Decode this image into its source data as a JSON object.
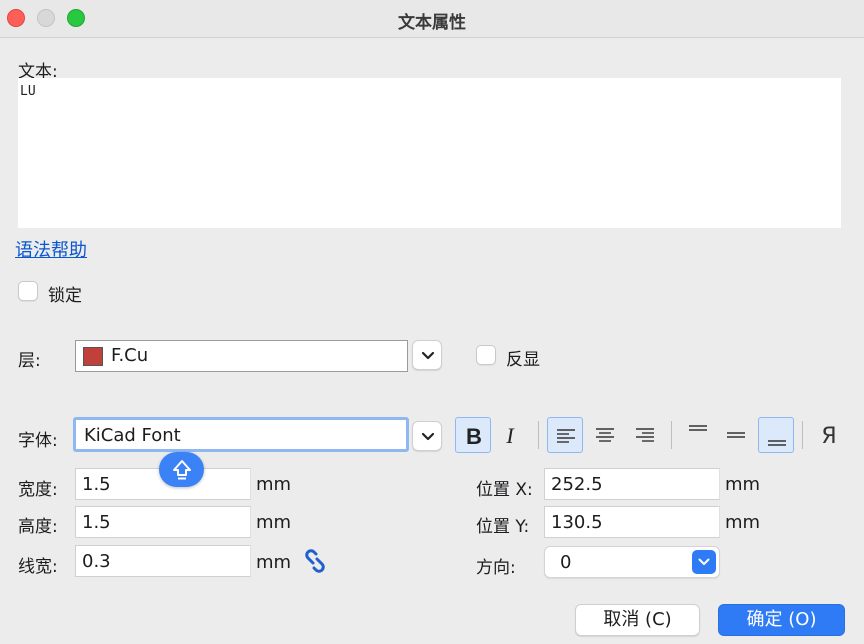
{
  "window": {
    "title": "文本属性"
  },
  "text_section": {
    "label": "文本:",
    "value": "LU"
  },
  "syntax_help_link": "语法帮助",
  "lock": {
    "label": "锁定",
    "checked": false
  },
  "layer": {
    "label": "层:",
    "value": "F.Cu",
    "swatch_color": "#c0403a"
  },
  "mirror": {
    "label": "反显",
    "checked": false
  },
  "font": {
    "label": "字体:",
    "value": "KiCad Font"
  },
  "style_buttons": {
    "bold": {
      "glyph": "B",
      "active": true
    },
    "italic": {
      "glyph": "I",
      "active": false
    },
    "h_align": [
      "left",
      "center",
      "right"
    ],
    "h_align_selected": "left",
    "v_align": [
      "top",
      "center",
      "bottom"
    ],
    "v_align_selected": "bottom",
    "mirror_glyph": "Я"
  },
  "width": {
    "label": "宽度:",
    "value": "1.5",
    "unit": "mm"
  },
  "height": {
    "label": "高度:",
    "value": "1.5",
    "unit": "mm"
  },
  "thickness": {
    "label": "线宽:",
    "value": "0.3",
    "unit": "mm"
  },
  "pos_x": {
    "label": "位置 X:",
    "value": "252.5",
    "unit": "mm"
  },
  "pos_y": {
    "label": "位置 Y:",
    "value": "130.5",
    "unit": "mm"
  },
  "orientation": {
    "label": "方向:",
    "value": "0"
  },
  "buttons": {
    "cancel": "取消 (C)",
    "ok": "确定 (O)"
  },
  "colors": {
    "accent": "#2f7bf5",
    "focus_ring": "#8fb7f2",
    "link": "#0b57d0"
  }
}
